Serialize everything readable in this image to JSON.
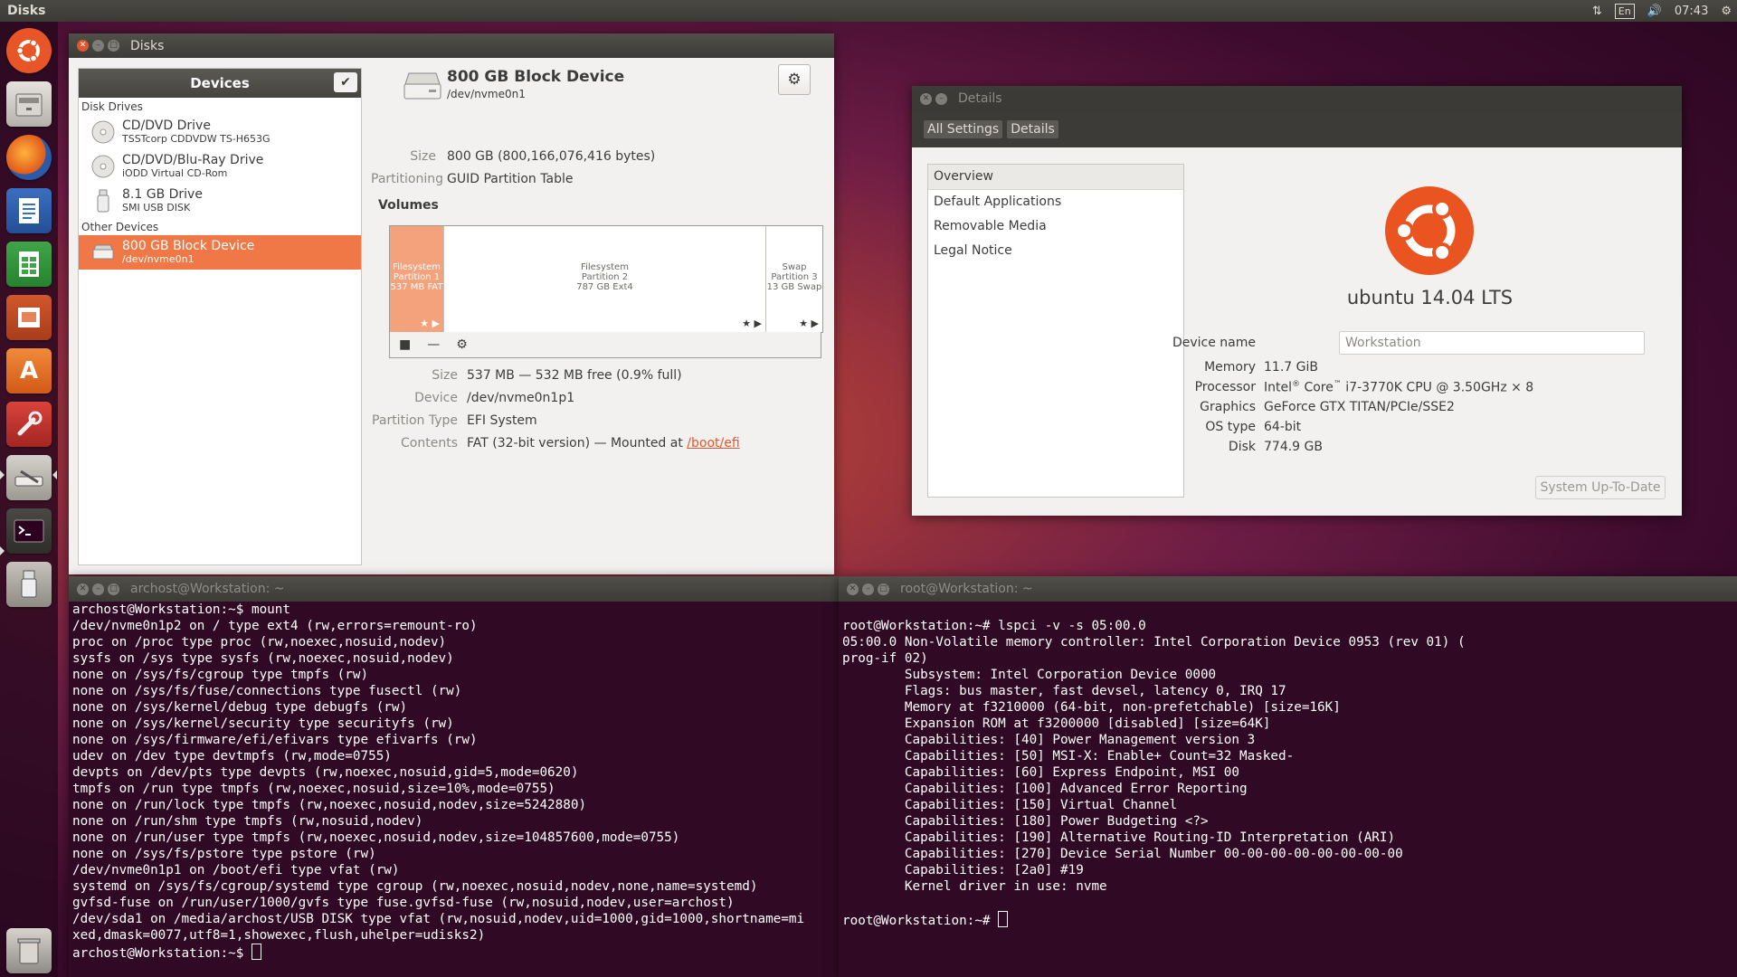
{
  "top_panel": {
    "title": "Disks",
    "keyboard": "En",
    "time": "07:43"
  },
  "launcher": {
    "items": [
      "ubuntu-dash-icon",
      "files-icon",
      "firefox-icon",
      "writer-icon",
      "calc-icon",
      "impress-icon",
      "software-center-icon",
      "system-settings-icon",
      "disks-icon",
      "terminal-icon",
      "usb-drive-icon",
      "trash-icon"
    ]
  },
  "disks": {
    "window_title": "Disks",
    "devices_header": "Devices",
    "section_disk_drives": "Disk Drives",
    "section_other_devices": "Other Devices",
    "drives": [
      {
        "name": "CD/DVD Drive",
        "sub": "TSSTcorp CDDVDW TS-H653G"
      },
      {
        "name": "CD/DVD/Blu-Ray Drive",
        "sub": "iODD Virtual CD-Rom"
      },
      {
        "name": "8.1 GB Drive",
        "sub": "SMI USB DISK"
      }
    ],
    "other": [
      {
        "name": "800 GB Block Device",
        "sub": "/dev/nvme0n1"
      }
    ],
    "device_title": "800 GB Block Device",
    "device_path": "/dev/nvme0n1",
    "size_label": "Size",
    "size_value": "800 GB (800,166,076,416 bytes)",
    "partitioning_label": "Partitioning",
    "partitioning_value": "GUID Partition Table",
    "volumes_label": "Volumes",
    "partitions": [
      {
        "l1": "Filesystem",
        "l2": "Partition 1",
        "l3": "537 MB FAT",
        "fraction": 0.0007
      },
      {
        "l1": "Filesystem",
        "l2": "Partition 2",
        "l3": "787 GB Ext4",
        "fraction": 0.983
      },
      {
        "l1": "Swap",
        "l2": "Partition 3",
        "l3": "13 GB Swap",
        "fraction": 0.016
      }
    ],
    "vol_size_label": "Size",
    "vol_size_value": "537 MB — 532 MB free (0.9% full)",
    "vol_device_label": "Device",
    "vol_device_value": "/dev/nvme0n1p1",
    "vol_type_label": "Partition Type",
    "vol_type_value": "EFI System",
    "vol_contents_label": "Contents",
    "vol_contents_value": "FAT (32-bit version) — Mounted at ",
    "vol_mount_link": "/boot/efi"
  },
  "details": {
    "window_title": "Details",
    "toolbar_all_settings": "All Settings",
    "toolbar_details": "Details",
    "nav": [
      "Overview",
      "Default Applications",
      "Removable Media",
      "Legal Notice"
    ],
    "os_name": "ubuntu 14.04 LTS",
    "device_name_label": "Device name",
    "device_name_value": "Workstation",
    "memory_label": "Memory",
    "memory_value": "11.7 GiB",
    "processor_label": "Processor",
    "processor_value_a": "Intel",
    "processor_value_b": "®",
    "processor_value_c": " Core",
    "processor_value_d": "™",
    "processor_value_e": " i7-3770K CPU @ 3.50GHz × 8",
    "graphics_label": "Graphics",
    "graphics_value": "GeForce GTX TITAN/PCIe/SSE2",
    "ostype_label": "OS type",
    "ostype_value": "64-bit",
    "disk_label": "Disk",
    "disk_value": "774.9 GB",
    "update_button": "System Up-To-Date"
  },
  "term1": {
    "title": "archost@Workstation: ~",
    "lines": [
      "archost@Workstation:~$ mount",
      "/dev/nvme0n1p2 on / type ext4 (rw,errors=remount-ro)",
      "proc on /proc type proc (rw,noexec,nosuid,nodev)",
      "sysfs on /sys type sysfs (rw,noexec,nosuid,nodev)",
      "none on /sys/fs/cgroup type tmpfs (rw)",
      "none on /sys/fs/fuse/connections type fusectl (rw)",
      "none on /sys/kernel/debug type debugfs (rw)",
      "none on /sys/kernel/security type securityfs (rw)",
      "none on /sys/firmware/efi/efivars type efivarfs (rw)",
      "udev on /dev type devtmpfs (rw,mode=0755)",
      "devpts on /dev/pts type devpts (rw,noexec,nosuid,gid=5,mode=0620)",
      "tmpfs on /run type tmpfs (rw,noexec,nosuid,size=10%,mode=0755)",
      "none on /run/lock type tmpfs (rw,noexec,nosuid,nodev,size=5242880)",
      "none on /run/shm type tmpfs (rw,nosuid,nodev)",
      "none on /run/user type tmpfs (rw,noexec,nosuid,nodev,size=104857600,mode=0755)",
      "none on /sys/fs/pstore type pstore (rw)",
      "/dev/nvme0n1p1 on /boot/efi type vfat (rw)",
      "systemd on /sys/fs/cgroup/systemd type cgroup (rw,noexec,nosuid,nodev,none,name=systemd)",
      "gvfsd-fuse on /run/user/1000/gvfs type fuse.gvfsd-fuse (rw,nosuid,nodev,user=archost)",
      "/dev/sda1 on /media/archost/USB DISK type vfat (rw,nosuid,nodev,uid=1000,gid=1000,shortname=mi",
      "xed,dmask=0077,utf8=1,showexec,flush,uhelper=udisks2)"
    ],
    "prompt": "archost@Workstation:~$ "
  },
  "term2": {
    "title": "root@Workstation: ~",
    "lines": [
      "",
      "root@Workstation:~# lspci -v -s 05:00.0",
      "05:00.0 Non-Volatile memory controller: Intel Corporation Device 0953 (rev 01) (",
      "prog-if 02)",
      "        Subsystem: Intel Corporation Device 0000",
      "        Flags: bus master, fast devsel, latency 0, IRQ 17",
      "        Memory at f3210000 (64-bit, non-prefetchable) [size=16K]",
      "        Expansion ROM at f3200000 [disabled] [size=64K]",
      "        Capabilities: [40] Power Management version 3",
      "        Capabilities: [50] MSI-X: Enable+ Count=32 Masked-",
      "        Capabilities: [60] Express Endpoint, MSI 00",
      "        Capabilities: [100] Advanced Error Reporting",
      "        Capabilities: [150] Virtual Channel",
      "        Capabilities: [180] Power Budgeting <?>",
      "        Capabilities: [190] Alternative Routing-ID Interpretation (ARI)",
      "        Capabilities: [270] Device Serial Number 00-00-00-00-00-00-00-00",
      "        Capabilities: [2a0] #19",
      "        Kernel driver in use: nvme",
      ""
    ],
    "prompt": "root@Workstation:~# "
  }
}
